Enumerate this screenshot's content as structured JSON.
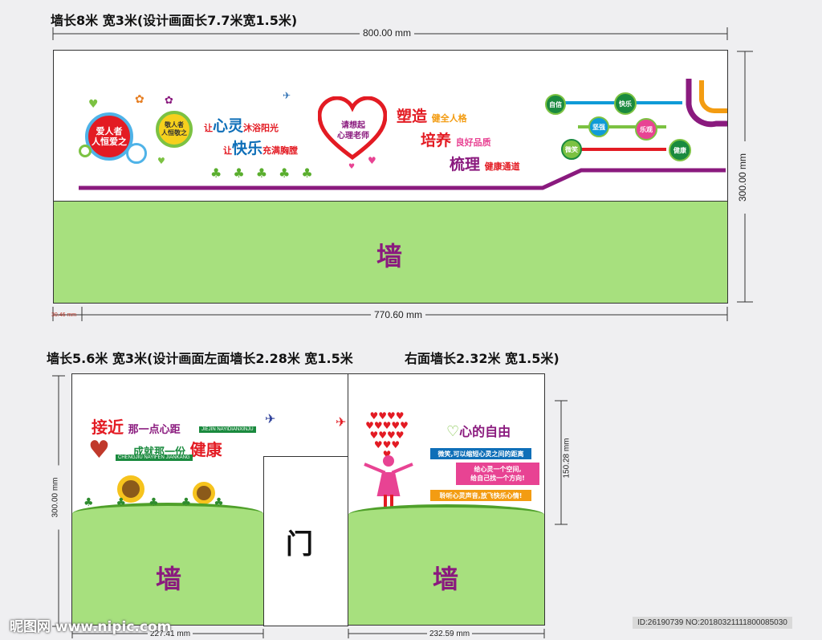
{
  "top": {
    "header": "墙长8米  宽3米(设计画面长7.7米宽1.5米)",
    "width_label": "800.00 mm",
    "height_label": "300.00 mm",
    "bottom_label": "770.60 mm",
    "offset_label": "30.46 mm",
    "wall_label": "墙",
    "circle_big": "爱人者\n人恒爱之",
    "circle_small": "敬人者\n人恒敬之",
    "heart_text": "请想起\n心理老师",
    "slogan1_small": "让",
    "slogan1_big": "心灵",
    "slogan1_rest": "沐浴阳光",
    "slogan2_small": "让",
    "slogan2_big": "快乐",
    "slogan2_rest": "充满胸膛",
    "right_lines": [
      {
        "big": "塑造",
        "small": "健全人格"
      },
      {
        "big": "培养",
        "small": "良好品质"
      },
      {
        "big": "梳理",
        "small": "健康通道"
      }
    ],
    "nodes": [
      "自信",
      "快乐",
      "坚强",
      "乐观",
      "微笑",
      "健康"
    ]
  },
  "bottom": {
    "header_left": "墙长5.6米  宽3米(设计画面左面墙长2.28米 宽1.5米",
    "header_right": "右面墙长2.32米 宽1.5米)",
    "left_height": "300.00 mm",
    "right_height": "150.28 mm",
    "left_width": "227.41 mm",
    "right_width": "232.59 mm",
    "door": "门",
    "wall_left": "墙",
    "wall_right": "墙",
    "left_title1_big": "接近",
    "left_title1_small": "那一点心距",
    "left_title1_en": "JIEJIN NAYIDIANXINJU",
    "left_title2_small": "成就那一份",
    "left_title2_big": "健康",
    "left_title2_en": "CHENGJIU NAYIFEN JIANKANG",
    "right_title": "心的自由",
    "right_lines": [
      "微笑,可以缩短心灵之间的距离",
      "给心灵一个空间,\n给自己找一个方向!",
      "聆听心灵声音,放飞快乐心情!"
    ]
  },
  "footer": {
    "watermark_left": "昵图网 www.nipic.com",
    "watermark_right": "ID:26190739 NO:20180321111800085030"
  },
  "colors": {
    "wall_green": "#a7e07e",
    "purple": "#8a1a7e",
    "red": "#e31b23",
    "blue": "#0f6fb8"
  }
}
